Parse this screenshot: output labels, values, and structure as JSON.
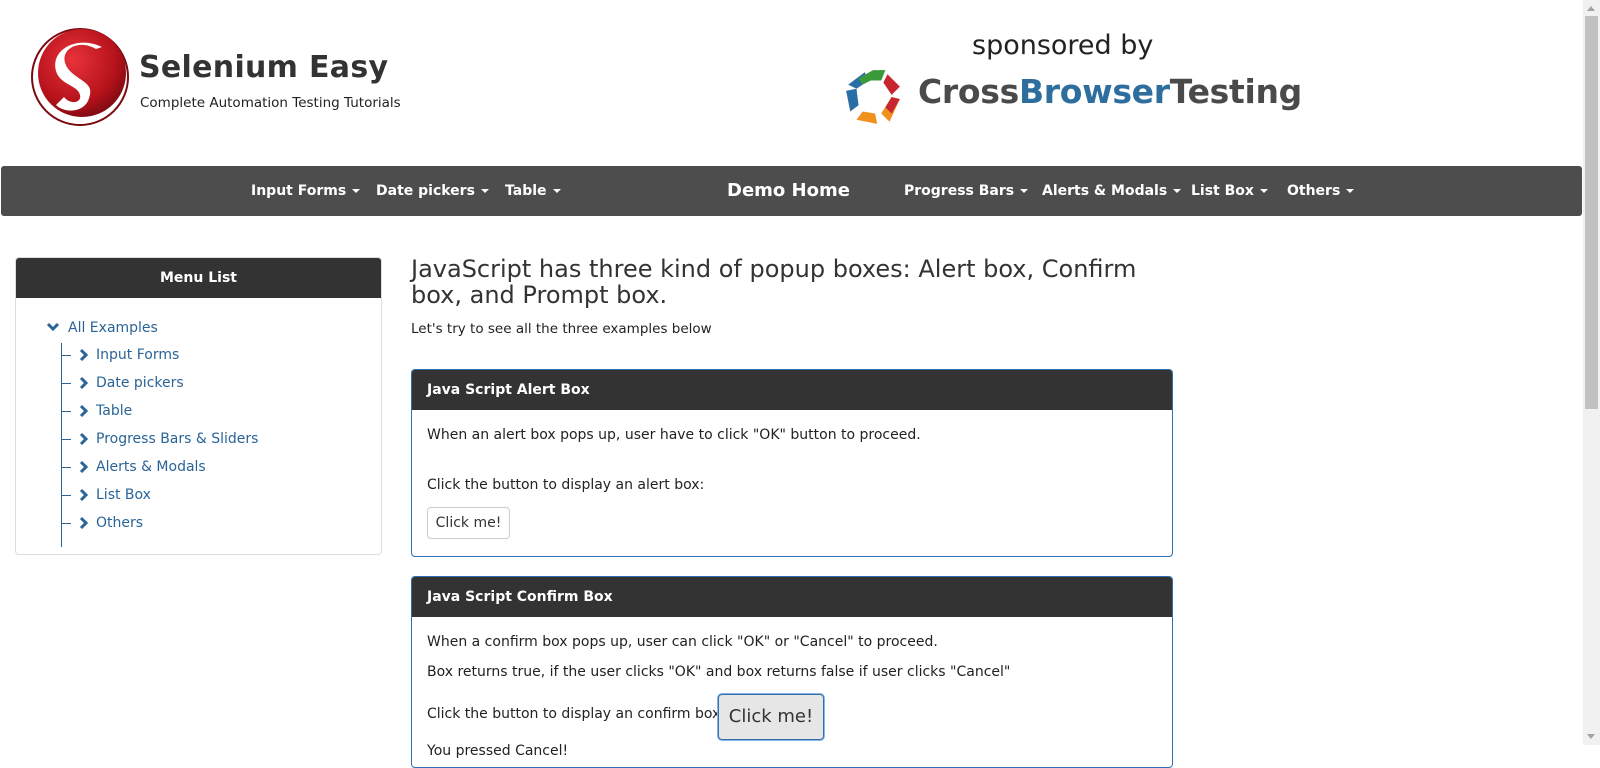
{
  "header": {
    "site_title": "Selenium Easy",
    "site_subtitle": "Complete Automation Testing Tutorials",
    "sponsor_label": "sponsored by",
    "sponsor_name_part1": "Cross",
    "sponsor_name_part2": "Browser",
    "sponsor_name_part3": "Testing",
    "logo_icon": "selenium-easy-logo",
    "sponsor_icon": "crossbrowsertesting-logo"
  },
  "navbar": {
    "items_left": [
      "Input Forms",
      "Date pickers",
      "Table"
    ],
    "home": "Demo Home",
    "items_right": [
      "Progress Bars",
      "Alerts & Modals",
      "List Box",
      "Others"
    ]
  },
  "sidebar": {
    "title": "Menu List",
    "root": "All Examples",
    "items": [
      "Input Forms",
      "Date pickers",
      "Table",
      "Progress Bars & Sliders",
      "Alerts & Modals",
      "List Box",
      "Others"
    ]
  },
  "main": {
    "heading": "JavaScript has three kind of popup boxes: Alert box, Confirm box, and Prompt box.",
    "subheading": "Let's try to see all the three examples below",
    "alert_panel": {
      "title": "Java Script Alert Box",
      "description": "When an alert box pops up, user have to click \"OK\" button to proceed.",
      "instruction": "Click the button to display an alert box:",
      "button_label": "Click me!"
    },
    "confirm_panel": {
      "title": "Java Script Confirm Box",
      "description1": "When a confirm box pops up, user can click \"OK\" or \"Cancel\" to proceed.",
      "description2": "Box returns true, if the user clicks \"OK\" and box returns false if user clicks \"Cancel\"",
      "instruction": "Click the button to display an confirm box:",
      "button_label": "Click me!",
      "result_text": "You pressed Cancel!"
    }
  },
  "colors": {
    "navbar_bg": "#4d4d4d",
    "panel_header_bg": "#333333",
    "link": "#2a6496",
    "panel_border": "#2f6faf"
  }
}
